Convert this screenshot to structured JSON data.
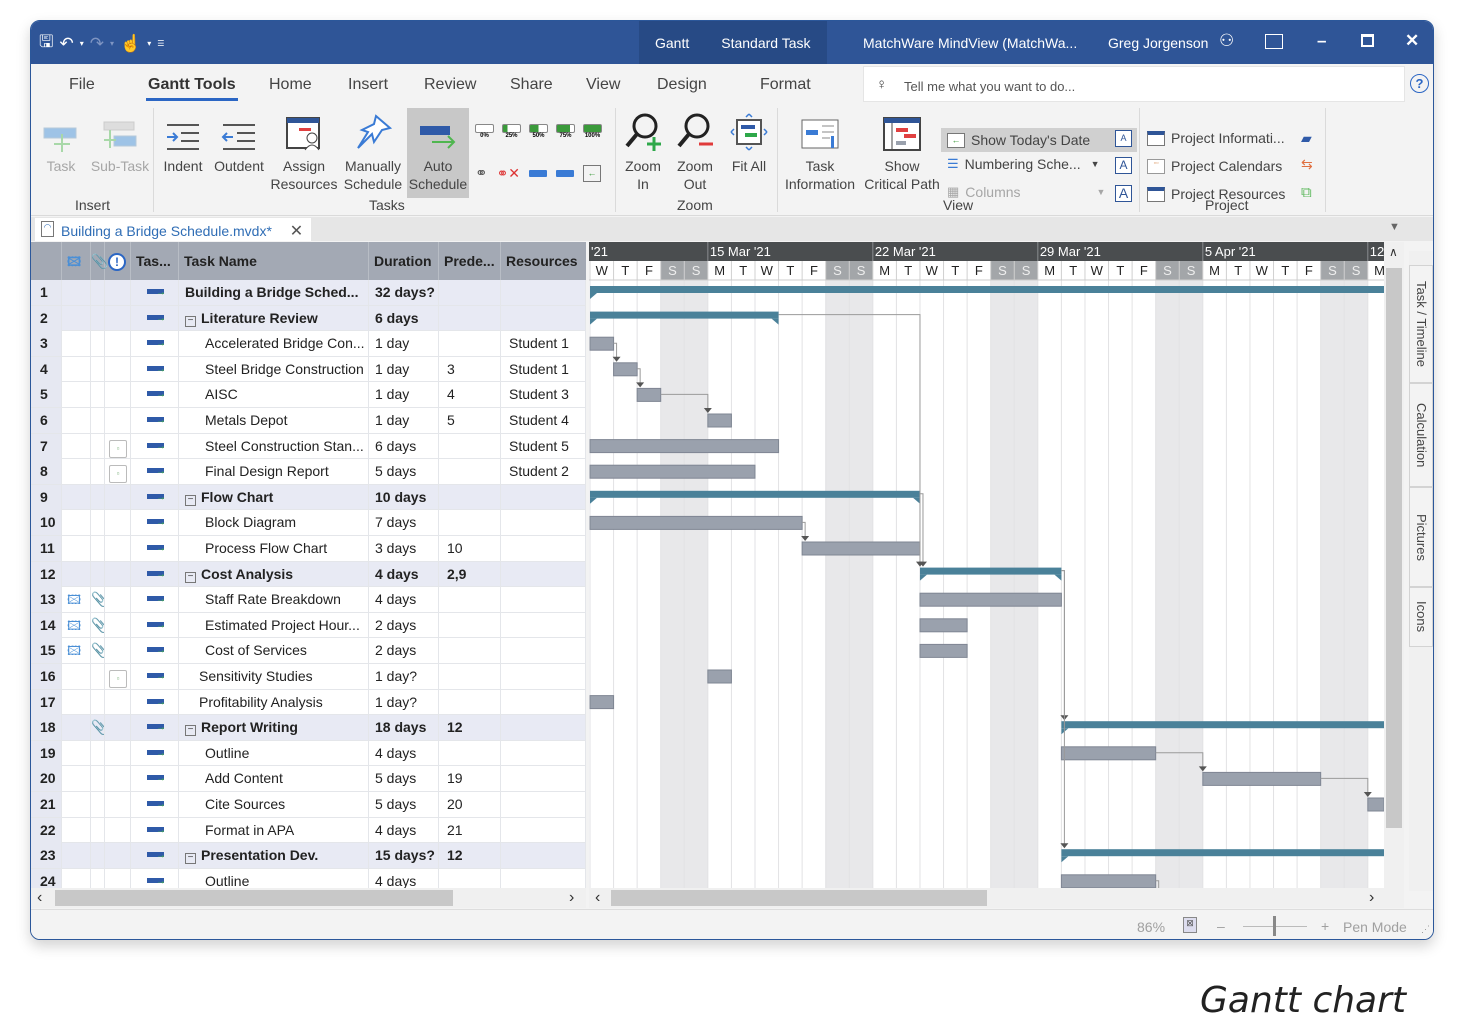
{
  "titlebar": {
    "context_tabs": [
      "Gantt",
      "Standard Task"
    ],
    "title": "MatchWare MindView (MatchWa...",
    "user": "Greg Jorgenson",
    "icons": [
      "save-icon",
      "undo-icon",
      "redo-icon",
      "touch-mode-icon",
      "customize-qat-icon",
      "user-icon",
      "ribbon-display-icon",
      "minimize-icon",
      "maximize-icon",
      "close-icon"
    ]
  },
  "menu": {
    "items": [
      "File",
      "Gantt Tools",
      "Home",
      "Insert",
      "Review",
      "Share",
      "View",
      "Design",
      "Format"
    ],
    "active": "Gantt Tools",
    "tellme_placeholder": "Tell me what you want to do...",
    "help": "?"
  },
  "ribbon": {
    "groups": {
      "insert": {
        "label": "Insert",
        "buttons": [
          "Task",
          "Sub-Task"
        ]
      },
      "tasks": {
        "label": "Tasks",
        "buttons": [
          "Indent",
          "Outdent",
          "Assign Resources",
          "Manually Schedule",
          "Auto Schedule"
        ],
        "progress_labels": [
          "0%",
          "25%",
          "50%",
          "75%",
          "100%"
        ]
      },
      "zoom": {
        "label": "Zoom",
        "buttons": [
          "Zoom In",
          "Zoom Out",
          "Fit All"
        ]
      },
      "view": {
        "label": "View",
        "buttons": [
          "Task Information",
          "Show Critical Path"
        ],
        "small": [
          "Show Today's Date",
          "Numbering Sche...",
          "Columns"
        ]
      },
      "project": {
        "label": "Project",
        "small": [
          "Project Informati...",
          "Project Calendars",
          "Project Resources"
        ]
      }
    }
  },
  "document_tab": {
    "label": "Building a Bridge Schedule.mvdx*",
    "close": "✕"
  },
  "grid": {
    "columns": [
      "",
      "",
      "",
      "!",
      "Tas...",
      "Task Name",
      "Duration",
      "Prede...",
      "Resources"
    ],
    "rows": [
      {
        "id": "1",
        "name": "Building a Bridge Sched...",
        "duration": "32 days?",
        "pred": "",
        "resource": "",
        "summary": true,
        "indent": 0,
        "icons": []
      },
      {
        "id": "2",
        "name": "Literature Review",
        "duration": "6 days",
        "pred": "",
        "resource": "",
        "summary": true,
        "indent": 1,
        "icons": []
      },
      {
        "id": "3",
        "name": "Accelerated Bridge Con...",
        "duration": "1 day",
        "pred": "",
        "resource": "Student 1",
        "summary": false,
        "indent": 2,
        "icons": []
      },
      {
        "id": "4",
        "name": "Steel Bridge Construction",
        "duration": "1 day",
        "pred": "3",
        "resource": "Student 1",
        "summary": false,
        "indent": 2,
        "icons": []
      },
      {
        "id": "5",
        "name": "AISC",
        "duration": "1 day",
        "pred": "4",
        "resource": "Student 3",
        "summary": false,
        "indent": 2,
        "icons": []
      },
      {
        "id": "6",
        "name": "Metals Depot",
        "duration": "1 day",
        "pred": "5",
        "resource": "Student 4",
        "summary": false,
        "indent": 2,
        "icons": []
      },
      {
        "id": "7",
        "name": "Steel Construction Stan...",
        "duration": "6 days",
        "pred": "",
        "resource": "Student 5",
        "summary": false,
        "indent": 2,
        "icons": [
          "calendar"
        ]
      },
      {
        "id": "8",
        "name": "Final Design Report",
        "duration": "5 days",
        "pred": "",
        "resource": "Student 2",
        "summary": false,
        "indent": 2,
        "icons": [
          "calendar"
        ]
      },
      {
        "id": "9",
        "name": "Flow Chart",
        "duration": "10 days",
        "pred": "",
        "resource": "",
        "summary": true,
        "indent": 1,
        "icons": []
      },
      {
        "id": "10",
        "name": "Block Diagram",
        "duration": "7 days",
        "pred": "",
        "resource": "",
        "summary": false,
        "indent": 2,
        "icons": []
      },
      {
        "id": "11",
        "name": "Process Flow Chart",
        "duration": "3 days",
        "pred": "10",
        "resource": "",
        "summary": false,
        "indent": 2,
        "icons": []
      },
      {
        "id": "12",
        "name": "Cost Analysis",
        "duration": "4 days",
        "pred": "2,9",
        "resource": "",
        "summary": true,
        "indent": 1,
        "icons": []
      },
      {
        "id": "13",
        "name": "Staff Rate Breakdown",
        "duration": "4 days",
        "pred": "",
        "resource": "",
        "summary": false,
        "indent": 2,
        "icons": [
          "image",
          "clip"
        ]
      },
      {
        "id": "14",
        "name": "Estimated Project Hour...",
        "duration": "2 days",
        "pred": "",
        "resource": "",
        "summary": false,
        "indent": 2,
        "icons": [
          "image",
          "clip"
        ]
      },
      {
        "id": "15",
        "name": "Cost of Services",
        "duration": "2 days",
        "pred": "",
        "resource": "",
        "summary": false,
        "indent": 2,
        "icons": [
          "image",
          "clip"
        ]
      },
      {
        "id": "16",
        "name": "Sensitivity Studies",
        "duration": "1 day?",
        "pred": "",
        "resource": "",
        "summary": false,
        "indent": 1,
        "icons": [
          "calendar"
        ]
      },
      {
        "id": "17",
        "name": "Profitability Analysis",
        "duration": "1 day?",
        "pred": "",
        "resource": "",
        "summary": false,
        "indent": 1,
        "icons": []
      },
      {
        "id": "18",
        "name": "Report Writing",
        "duration": "18 days",
        "pred": "12",
        "resource": "",
        "summary": true,
        "indent": 1,
        "icons": [
          "clip"
        ]
      },
      {
        "id": "19",
        "name": "Outline",
        "duration": "4 days",
        "pred": "",
        "resource": "",
        "summary": false,
        "indent": 2,
        "icons": []
      },
      {
        "id": "20",
        "name": "Add Content",
        "duration": "5 days",
        "pred": "19",
        "resource": "",
        "summary": false,
        "indent": 2,
        "icons": []
      },
      {
        "id": "21",
        "name": "Cite Sources",
        "duration": "5 days",
        "pred": "20",
        "resource": "",
        "summary": false,
        "indent": 2,
        "icons": []
      },
      {
        "id": "22",
        "name": "Format in APA",
        "duration": "4 days",
        "pred": "21",
        "resource": "",
        "summary": false,
        "indent": 2,
        "icons": []
      },
      {
        "id": "23",
        "name": "Presentation Dev.",
        "duration": "15 days?",
        "pred": "12",
        "resource": "",
        "summary": true,
        "indent": 1,
        "icons": []
      },
      {
        "id": "24",
        "name": "Outline",
        "duration": "4 days",
        "pred": "",
        "resource": "",
        "summary": false,
        "indent": 2,
        "icons": []
      }
    ]
  },
  "chart_data": {
    "type": "gantt",
    "timescale": {
      "weeks": [
        "'21",
        "15 Mar '21",
        "22 Mar '21",
        "29 Mar '21",
        "5 Apr '21",
        "12"
      ],
      "first_day_label_index": 2,
      "day_letters": [
        "M",
        "T",
        "W",
        "T",
        "F",
        "S",
        "S"
      ],
      "visible_days": 34,
      "start_weekday_index": 2
    },
    "bars": [
      {
        "row": 1,
        "start": 0,
        "end": 34,
        "kind": "summary"
      },
      {
        "row": 2,
        "start": 0,
        "end": 8,
        "kind": "summary"
      },
      {
        "row": 3,
        "start": 0,
        "end": 1,
        "kind": "task"
      },
      {
        "row": 4,
        "start": 1,
        "end": 2,
        "kind": "task"
      },
      {
        "row": 5,
        "start": 2,
        "end": 3,
        "kind": "task"
      },
      {
        "row": 6,
        "start": 5,
        "end": 6,
        "kind": "task"
      },
      {
        "row": 7,
        "start": 0,
        "end": 8,
        "kind": "task"
      },
      {
        "row": 8,
        "start": 0,
        "end": 7,
        "kind": "task"
      },
      {
        "row": 9,
        "start": 0,
        "end": 14,
        "kind": "summary"
      },
      {
        "row": 10,
        "start": 0,
        "end": 9,
        "kind": "task"
      },
      {
        "row": 11,
        "start": 9,
        "end": 14,
        "kind": "task"
      },
      {
        "row": 12,
        "start": 14,
        "end": 20,
        "kind": "summary"
      },
      {
        "row": 13,
        "start": 14,
        "end": 20,
        "kind": "task"
      },
      {
        "row": 14,
        "start": 14,
        "end": 16,
        "kind": "task"
      },
      {
        "row": 15,
        "start": 14,
        "end": 16,
        "kind": "task"
      },
      {
        "row": 16,
        "start": 5,
        "end": 6,
        "kind": "task"
      },
      {
        "row": 17,
        "start": 0,
        "end": 1,
        "kind": "task"
      },
      {
        "row": 18,
        "start": 20,
        "end": 34,
        "kind": "summary"
      },
      {
        "row": 19,
        "start": 20,
        "end": 24,
        "kind": "task"
      },
      {
        "row": 20,
        "start": 26,
        "end": 31,
        "kind": "task"
      },
      {
        "row": 21,
        "start": 33,
        "end": 34,
        "kind": "task"
      },
      {
        "row": 23,
        "start": 20,
        "end": 34,
        "kind": "summary"
      },
      {
        "row": 24,
        "start": 20,
        "end": 24,
        "kind": "task"
      }
    ],
    "links": [
      {
        "from": 3,
        "to": 4
      },
      {
        "from": 4,
        "to": 5
      },
      {
        "from": 5,
        "to": 6
      },
      {
        "from": 10,
        "to": 11
      },
      {
        "from": 2,
        "to": 12
      },
      {
        "from": 9,
        "to": 12
      },
      {
        "from": 12,
        "to": 18
      },
      {
        "from": 12,
        "to": 23
      },
      {
        "from": 19,
        "to": 20
      },
      {
        "from": 20,
        "to": 21
      },
      {
        "from": 24,
        "to": 25
      }
    ],
    "colors": {
      "summary": "#4a8199",
      "task": "#9aa1ad",
      "weekend": "#e8e8ea",
      "header_dark": "#4a4d4f",
      "weekend_header": "#a3a6a9"
    }
  },
  "side_tabs": [
    "Task / Timeline",
    "Calculation",
    "Pictures",
    "Icons"
  ],
  "status": {
    "zoom": "86%",
    "pen_mode": "Pen Mode",
    "minus": "–",
    "plus": "+"
  },
  "caption": "Gantt chart"
}
